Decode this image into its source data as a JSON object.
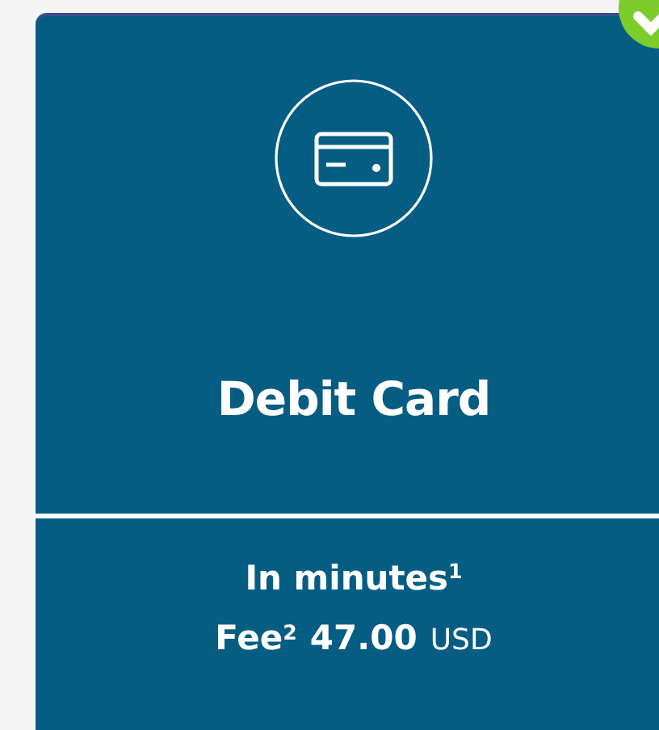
{
  "card": {
    "title": "Debit Card",
    "selected": true,
    "speed": "In minutes$^{1}$",
    "fee_label": "Fee$^{2}$",
    "amount": "47.00",
    "currency": "USD"
  }
}
